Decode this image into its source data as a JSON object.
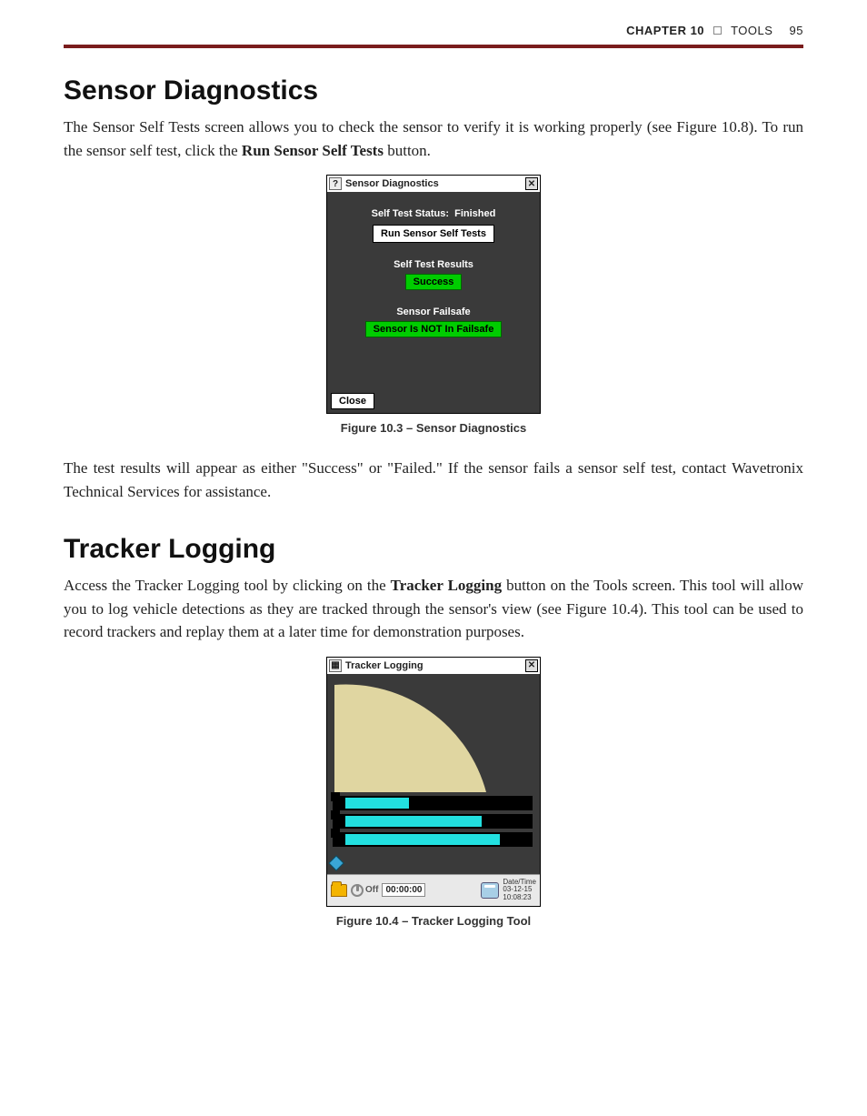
{
  "header": {
    "chapter_label": "CHAPTER 10",
    "section_label": "TOOLS",
    "page_number": "95"
  },
  "section1": {
    "heading": "Sensor Diagnostics",
    "para1_a": "The Sensor Self Tests screen allows you to check the sensor to verify it is working properly (see Figure 10.8). To run the sensor self test, click the ",
    "para1_bold": "Run Sensor Self Tests",
    "para1_b": " button.",
    "figcap": "Figure 10.3 – Sensor Diagnostics",
    "para2": "The test results will appear as either \"Success\" or \"Failed.\" If the sensor fails a sensor self test, contact Wavetronix Technical Services for assistance."
  },
  "dialog1": {
    "title": "Sensor Diagnostics",
    "status_label": "Self Test Status:",
    "status_value": "Finished",
    "run_button": "Run Sensor Self Tests",
    "results_label": "Self Test Results",
    "results_value": "Success",
    "failsafe_label": "Sensor Failsafe",
    "failsafe_value": "Sensor Is NOT In Failsafe",
    "close_label": "Close",
    "help_glyph": "?",
    "close_glyph": "✕"
  },
  "section2": {
    "heading": "Tracker Logging",
    "para1_a": "Access the Tracker Logging tool by clicking on the ",
    "para1_bold": "Tracker Logging",
    "para1_b": " button on the Tools screen. This tool will allow you to log vehicle detections as they are tracked through the sensor's view (see Figure 10.4). This tool can be used to record trackers and replay them at a later time for demonstration purposes.",
    "figcap": "Figure 10.4 – Tracker Logging Tool"
  },
  "dialog2": {
    "title": "Tracker Logging",
    "grid_glyph": "▦",
    "close_glyph": "✕",
    "off_label": "Off",
    "time_value": "00:00:00",
    "datetime_label": "Date/Time",
    "date_value": "03-12-15",
    "time_of_day": "10:08:23"
  },
  "chart_data": null
}
